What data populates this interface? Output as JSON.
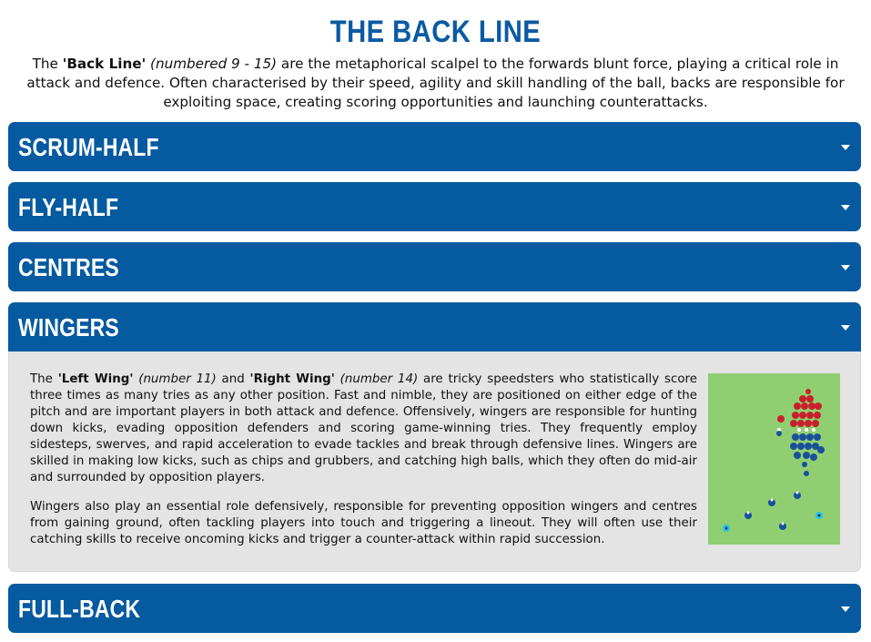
{
  "page": {
    "title": "THE BACK LINE",
    "intro": {
      "p1": "The ",
      "bold1": "'Back Line'",
      "p2": " ",
      "italic1": "(numbered 9 - 15)",
      "p3": " are the metaphorical scalpel to the forwards blunt force, playing a critical role in attack and defence. Often characterised by their speed, agility and skill handling of the ball, backs are responsible for exploiting space, creating scoring opportunities and launching counterattacks."
    }
  },
  "accordion": {
    "sections": [
      {
        "label": "SCRUM-HALF",
        "expanded": false
      },
      {
        "label": "FLY-HALF",
        "expanded": false
      },
      {
        "label": "CENTRES",
        "expanded": false
      },
      {
        "label": "WINGERS",
        "expanded": true
      },
      {
        "label": "FULL-BACK",
        "expanded": false
      }
    ],
    "wingers": {
      "para1": {
        "a": "The ",
        "b": "'Left Wing'",
        "c": " ",
        "d": "(number 11)",
        "e": " and ",
        "f": "'Right Wing'",
        "g": " ",
        "h": "(number 14)",
        "i": " are tricky speedsters who statistically score three times as many tries as any other position. Fast and nimble, they are positioned on either edge of the pitch and are important players in both attack and defence. Offensively, wingers are responsible for hunting down kicks, evading opposition defenders and scoring game-winning tries. They frequently employ sidesteps, swerves, and rapid acceleration to evade tackles and break through defensive lines. Wingers are skilled in making low kicks, such as chips and grubbers, and catching high balls, which they often do mid-air and surrounded by opposition players."
      },
      "para2": "Wingers also play an essential role defensively, responsible for preventing opposition wingers and centres from gaining ground, often tackling players into touch and triggering a lineout. They will often use their catching skills to receive oncoming kicks and trigger a counter-attack within rapid succession.",
      "diagram_icon": "rugby-formation-illustration"
    }
  },
  "colors": {
    "title": "#0b5aa3",
    "header_bg": "#055aa0",
    "body_bg": "#e4e4e4",
    "pitch": "#8fcf72",
    "red_team": "#c8202a",
    "blue_team": "#1a4f9c",
    "light_blue": "#29c4e8"
  }
}
